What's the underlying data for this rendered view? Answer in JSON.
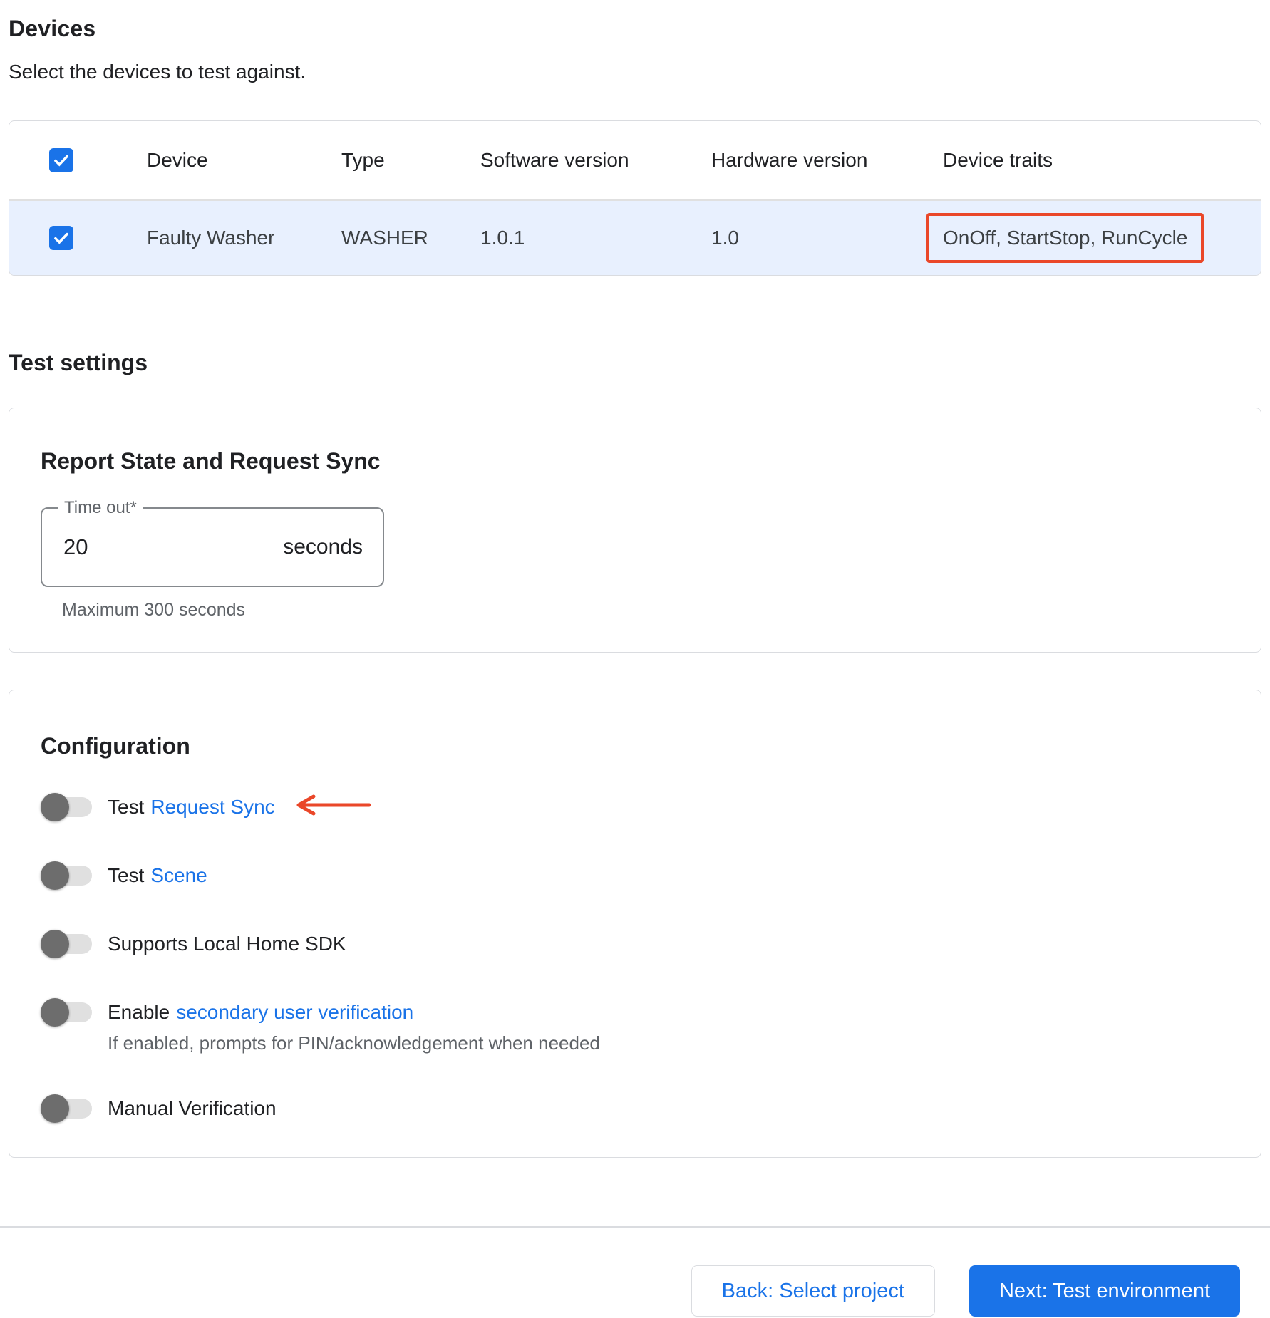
{
  "page": {
    "title": "Devices",
    "subtitle": "Select the devices to test against."
  },
  "devices_table": {
    "select_all_checked": true,
    "columns": [
      "Device",
      "Type",
      "Software version",
      "Hardware version",
      "Device traits"
    ],
    "rows": [
      {
        "checked": true,
        "device": "Faulty Washer",
        "type": "WASHER",
        "software_version": "1.0.1",
        "hardware_version": "1.0",
        "device_traits": "OnOff, StartStop, RunCycle",
        "device_traits_highlighted": true
      }
    ]
  },
  "test_settings": {
    "heading": "Test settings",
    "report_state_card": {
      "title": "Report State and Request Sync",
      "timeout_label": "Time out*",
      "timeout_value": "20",
      "timeout_unit": "seconds",
      "timeout_helper": "Maximum 300 seconds"
    },
    "configuration_card": {
      "title": "Configuration",
      "toggles": [
        {
          "label_plain": "Test",
          "label_link": "Request Sync",
          "state": "off",
          "annotated_with_arrow": true
        },
        {
          "label_plain": "Test",
          "label_link": "Scene",
          "state": "off"
        },
        {
          "label_plain": "Supports Local Home SDK",
          "label_link": "",
          "state": "off"
        },
        {
          "label_plain": "Enable",
          "label_link": "secondary user verification",
          "state": "off",
          "description": "If enabled, prompts for PIN/acknowledgement when needed"
        },
        {
          "label_plain": "Manual Verification",
          "label_link": "",
          "state": "off"
        }
      ]
    }
  },
  "footer": {
    "back_label": "Back: Select project",
    "next_label": "Next: Test environment"
  },
  "colors": {
    "accent_blue": "#1a73e8",
    "selected_row_background": "#e8f0fe",
    "annotation_red": "#ea4729",
    "toggle_thumb_gray": "#6d6d6d"
  },
  "icons": {
    "checkmark": "check-icon",
    "arrow_left": "left-arrow-annotation"
  }
}
